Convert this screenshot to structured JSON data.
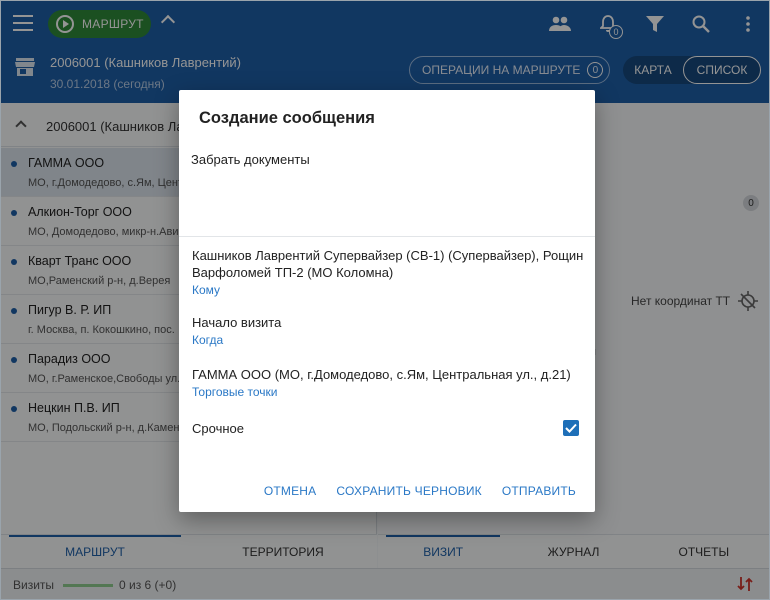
{
  "header": {
    "route_button": "МАРШРУТ",
    "bell_count": "0",
    "agent_title": "2006001 (Кашников Лаврентий)",
    "agent_date": "30.01.2018 (сегодня)",
    "ops_button": "ОПЕРАЦИИ НА МАРШРУТЕ",
    "ops_count": "0",
    "view_map": "КАРТА",
    "view_list": "СПИСОК"
  },
  "left": {
    "group_title": "2006001 (Кашников Лаврентий)",
    "outlets": [
      {
        "name": "ГАММА ООО",
        "address": "МО, г.Домодедово, с.Ям, Центральная ул., д.21"
      },
      {
        "name": "Алкион-Торг ООО",
        "address": "МО, Домодедово, микр-н.Авиационный"
      },
      {
        "name": "Кварт Транс ООО",
        "address": "МО,Раменский р-н, д.Верея"
      },
      {
        "name": "Пигур В. Р. ИП",
        "address": "г. Москва,  п. Кокошкино, пос."
      },
      {
        "name": "Парадиз ООО",
        "address": "МО, г.Раменское,Свободы ул."
      },
      {
        "name": "Нецкин П.В. ИП",
        "address": "МО, Подольский р-н, д.Каменка"
      }
    ],
    "tabs": [
      "МАРШРУТ",
      "ТЕРРИТОРИЯ"
    ]
  },
  "right": {
    "badge": "0",
    "no_coords": "Нет координат ТТ",
    "fragment": "ы",
    "tabs": [
      "ВИЗИТ",
      "ЖУРНАЛ",
      "ОТЧЕТЫ"
    ]
  },
  "status": {
    "visits_label": "Визиты",
    "visits_count": "0 из 6 (+0)"
  },
  "dialog": {
    "title": "Создание сообщения",
    "message": "Забрать документы",
    "recipients": "Кашников Лаврентий Супервайзер (СВ-1) (Супервайзер), Рощин Варфоломей ТП-2 (МО Коломна)",
    "recipients_link": "Кому",
    "when": "Начало визита",
    "when_link": "Когда",
    "outlet": "ГАММА ООО (МО, г.Домодедово, с.Ям, Центральная ул., д.21)",
    "outlet_link": "Торговые точки",
    "urgent_label": "Срочное",
    "urgent_checked": true,
    "cancel": "ОТМЕНА",
    "save_draft": "СОХРАНИТЬ ЧЕРНОВИК",
    "send": "ОТПРАВИТЬ"
  }
}
